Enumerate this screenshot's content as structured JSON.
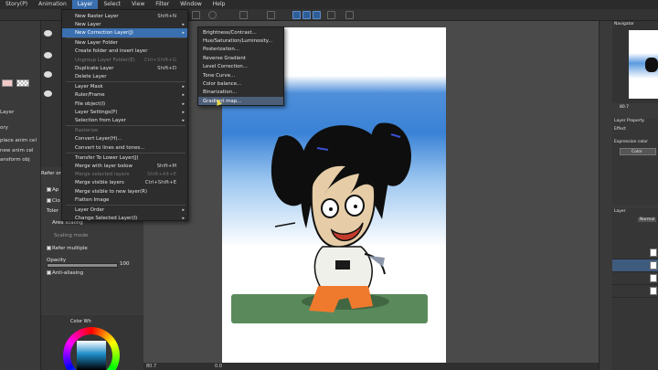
{
  "menubar": [
    "Story(P)",
    "Animation",
    "Layer",
    "Select",
    "View",
    "Filter",
    "Window",
    "Help"
  ],
  "layer_menu": [
    {
      "label": "New Raster Layer",
      "shortcut": "Shift+N",
      "arrow": false,
      "state": "normal"
    },
    {
      "label": "New Layer",
      "shortcut": "",
      "arrow": true,
      "state": "normal"
    },
    {
      "label": "New Correction Layer(J)",
      "shortcut": "",
      "arrow": true,
      "state": "highlight"
    },
    {
      "label": "New Layer Folder",
      "shortcut": "",
      "arrow": false,
      "state": "normal"
    },
    {
      "label": "Create folder and insert layer",
      "shortcut": "",
      "arrow": false,
      "state": "normal"
    },
    {
      "label": "Ungroup Layer Folder(E)",
      "shortcut": "Ctrl+Shift+G",
      "arrow": false,
      "state": "disabled"
    },
    {
      "label": "Duplicate Layer",
      "shortcut": "Shift+D",
      "arrow": false,
      "state": "normal"
    },
    {
      "label": "Delete Layer",
      "shortcut": "",
      "arrow": false,
      "state": "normal"
    },
    {
      "label": "Layer Mask",
      "shortcut": "",
      "arrow": true,
      "state": "normal"
    },
    {
      "label": "Ruler/Frame",
      "shortcut": "",
      "arrow": true,
      "state": "normal"
    },
    {
      "label": "File object(I)",
      "shortcut": "",
      "arrow": true,
      "state": "normal"
    },
    {
      "label": "Layer Settings(P)",
      "shortcut": "",
      "arrow": true,
      "state": "normal"
    },
    {
      "label": "Selection from Layer",
      "shortcut": "",
      "arrow": true,
      "state": "normal"
    },
    {
      "label": "Rasterize",
      "shortcut": "",
      "arrow": false,
      "state": "disabled"
    },
    {
      "label": "Convert Layer(H)...",
      "shortcut": "",
      "arrow": false,
      "state": "normal"
    },
    {
      "label": "Convert to lines and tones...",
      "shortcut": "",
      "arrow": false,
      "state": "normal"
    },
    {
      "label": "Transfer To Lower Layer(J)",
      "shortcut": "",
      "arrow": false,
      "state": "normal"
    },
    {
      "label": "Merge with layer below",
      "shortcut": "Shift+M",
      "arrow": false,
      "state": "normal"
    },
    {
      "label": "Merge selected layers",
      "shortcut": "Shift+Alt+E",
      "arrow": false,
      "state": "disabled"
    },
    {
      "label": "Merge visible layers",
      "shortcut": "Ctrl+Shift+E",
      "arrow": false,
      "state": "normal"
    },
    {
      "label": "Merge visible to new layer(R)",
      "shortcut": "",
      "arrow": false,
      "state": "normal"
    },
    {
      "label": "Flatten Image",
      "shortcut": "",
      "arrow": false,
      "state": "normal"
    },
    {
      "label": "Layer Order",
      "shortcut": "",
      "arrow": true,
      "state": "normal"
    },
    {
      "label": "Change Selected Layer(I)",
      "shortcut": "",
      "arrow": true,
      "state": "normal"
    }
  ],
  "correction_submenu": [
    {
      "label": "Brightness/Contrast...",
      "state": "normal"
    },
    {
      "label": "Hue/Saturation/Luminosity...",
      "state": "normal"
    },
    {
      "label": "Posterization...",
      "state": "normal"
    },
    {
      "label": "Reverse Gradient",
      "state": "normal"
    },
    {
      "label": "Level Correction...",
      "state": "normal"
    },
    {
      "label": "Tone Curve...",
      "state": "normal"
    },
    {
      "label": "Color balance...",
      "state": "normal"
    },
    {
      "label": "Binarization...",
      "state": "normal"
    },
    {
      "label": "Gradient map...",
      "state": "highlight"
    }
  ],
  "left_panel": {
    "items": [
      "Layer",
      "ory",
      "place anim cel",
      "new anim cel",
      "ansform obj"
    ]
  },
  "tool_property": {
    "refer_label": "Refer ord",
    "ap_label": "Ap",
    "cl_label": "Clo",
    "toler_label": "Toler",
    "area_scaling": "Area scaling",
    "scaling_mode": "Scaling mode",
    "refer_multiple": "Refer multiple",
    "opacity_label": "Opacity",
    "opacity_value": "100",
    "anti_alias": "Anti-aliasing",
    "color_wheel_label": "Color Wh"
  },
  "right_panel": {
    "navigator_title": "Navigator",
    "zoom_value": "80.7",
    "layer_property_title": "Layer Property",
    "effect_label": "Effect",
    "expression_label": "Expression color",
    "color_label": "Color",
    "layer_title": "Layer",
    "blend_mode": "Normal",
    "layers": [
      {
        "name": "Layer 1",
        "opacity": "100"
      },
      {
        "name": "Layer 2",
        "opacity": "100"
      },
      {
        "name": "Layer 3",
        "opacity": "100"
      },
      {
        "name": "Paper",
        "opacity": ""
      }
    ]
  },
  "status": {
    "zoom": "80.7",
    "angle": "0.0"
  },
  "colors": {
    "menu_bg": "#2d2d2d",
    "highlight": "#3a6fb0",
    "sky": "#3a82d6",
    "grass": "#5a8a5c"
  }
}
